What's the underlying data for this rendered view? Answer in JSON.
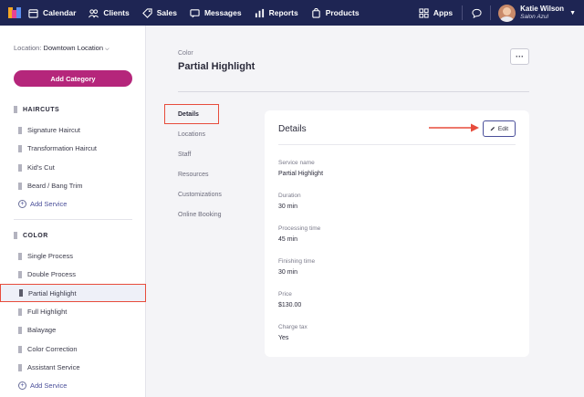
{
  "nav": {
    "items": [
      {
        "label": "Calendar",
        "icon": "calendar-icon"
      },
      {
        "label": "Clients",
        "icon": "clients-icon"
      },
      {
        "label": "Sales",
        "icon": "sales-tag-icon"
      },
      {
        "label": "Messages",
        "icon": "messages-icon"
      },
      {
        "label": "Reports",
        "icon": "reports-chart-icon"
      },
      {
        "label": "Products",
        "icon": "products-bag-icon"
      }
    ],
    "apps_label": "Apps",
    "user_name": "Katie Wilson",
    "salon": "Salon Azul"
  },
  "sidebar": {
    "location_label": "Location:",
    "location_value": "Downtown Location",
    "add_category": "Add Category",
    "sections": [
      {
        "title": "HAIRCUTS",
        "services": [
          "Signature Haircut",
          "Transformation Haircut",
          "Kid's Cut",
          "Beard / Bang Trim"
        ],
        "add_label": "Add Service"
      },
      {
        "title": "COLOR",
        "services": [
          "Single Process",
          "Double Process",
          "Partial Highlight",
          "Full Highlight",
          "Balayage",
          "Color Correction",
          "Assistant Service"
        ],
        "add_label": "Add Service"
      }
    ]
  },
  "main": {
    "category": "Color",
    "title": "Partial Highlight",
    "more_label": "···",
    "tabs": [
      "Details",
      "Locations",
      "Staff",
      "Resources",
      "Customizations",
      "Online Booking"
    ],
    "active_tab": "Details"
  },
  "card": {
    "title": "Details",
    "edit_label": "Edit",
    "fields": [
      {
        "label": "Service name",
        "value": "Partial Highlight"
      },
      {
        "label": "Duration",
        "value": "30 min"
      },
      {
        "label": "Processing time",
        "value": "45 min"
      },
      {
        "label": "Finishing time",
        "value": "30 min"
      },
      {
        "label": "Price",
        "value": "$130.00"
      },
      {
        "label": "Charge tax",
        "value": "Yes"
      }
    ]
  },
  "colors": {
    "nav_bg": "#1e2553",
    "accent": "#b5267b",
    "highlight_border": "#e74c3c"
  }
}
